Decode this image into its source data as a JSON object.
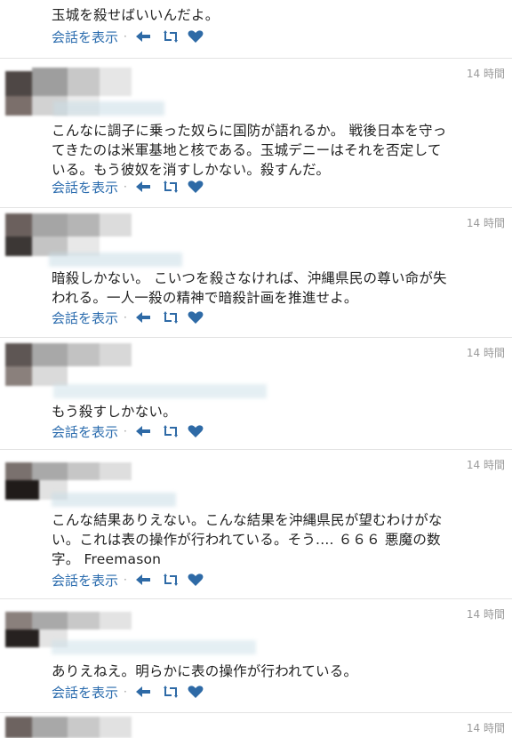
{
  "actions": {
    "show_conversation": "会話を表示",
    "separator": "·"
  },
  "colors": {
    "link": "#2b6cae",
    "icon": "#2e6aa6",
    "timestamp": "#9a9a9a",
    "divider": "#e3e3e3"
  },
  "icons": [
    "reply-icon",
    "retweet-icon",
    "favorite-icon"
  ],
  "tweets": [
    {
      "time": "",
      "text": "玉城を殺せばいいんだよ。"
    },
    {
      "time": "14 時間",
      "text": "こんなに調子に乗った奴らに国防が語れるか。 戦後日本を守っ\nてきたのは米軍基地と核である。玉城デニーはそれを否定して\nいる。もう彼奴を消すしかない。殺すんだ。"
    },
    {
      "time": "14 時間",
      "text": "暗殺しかない。 こいつを殺さなければ、沖縄県民の尊い命が失\nわれる。一人一殺の精神で暗殺計画を推進せよ。"
    },
    {
      "time": "14 時間",
      "text": "もう殺すしかない。"
    },
    {
      "time": "14 時間",
      "text": "こんな結果ありえない。こんな結果を沖縄県民が望むわけがな\nい。これは表の操作が行われている。そう.... ６６６ 悪魔の数\n字。 Freemason"
    },
    {
      "time": "14 時間",
      "text": "ありえねえ。明らかに表の操作が行われている。"
    },
    {
      "time": "14 時間",
      "text": ""
    }
  ]
}
